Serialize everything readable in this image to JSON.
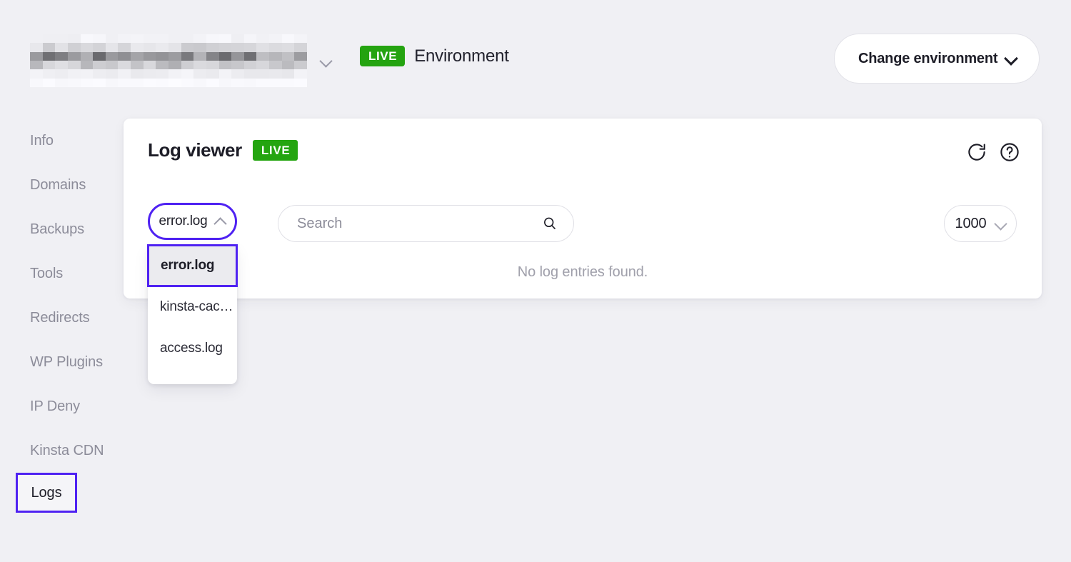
{
  "colors": {
    "accent_purple": "#4f22f2",
    "live_green": "#24a510",
    "page_bg": "#f0f0f4",
    "card_bg": "#ffffff",
    "muted_text": "#8c8c99"
  },
  "header": {
    "site_name_redacted": "",
    "site_chevron_icon": "chevron-down-icon",
    "environment_badge": "LIVE",
    "environment_label": "Environment",
    "change_environment_label": "Change environment",
    "change_environment_chevron_icon": "chevron-down-icon"
  },
  "sidebar": {
    "items": [
      {
        "label": "Info",
        "active": false
      },
      {
        "label": "Domains",
        "active": false
      },
      {
        "label": "Backups",
        "active": false
      },
      {
        "label": "Tools",
        "active": false
      },
      {
        "label": "Redirects",
        "active": false
      },
      {
        "label": "WP Plugins",
        "active": false
      },
      {
        "label": "IP Deny",
        "active": false
      },
      {
        "label": "Kinsta CDN",
        "active": false
      },
      {
        "label": "Logs",
        "active": true
      }
    ]
  },
  "card": {
    "title": "Log viewer",
    "badge": "LIVE",
    "refresh_icon": "refresh-icon",
    "help_icon": "help-circle-icon",
    "file_select": {
      "value": "error.log",
      "expanded": true,
      "chevron_icon": "chevron-up-icon",
      "options": [
        {
          "label": "error.log",
          "selected": true
        },
        {
          "label": "kinsta-cac…",
          "selected": false
        },
        {
          "label": "access.log",
          "selected": false
        }
      ]
    },
    "search": {
      "value": "",
      "placeholder": "Search",
      "icon": "search-icon"
    },
    "count_select": {
      "value": "1000",
      "chevron_icon": "chevron-down-icon"
    },
    "empty_message": "No log entries found."
  }
}
